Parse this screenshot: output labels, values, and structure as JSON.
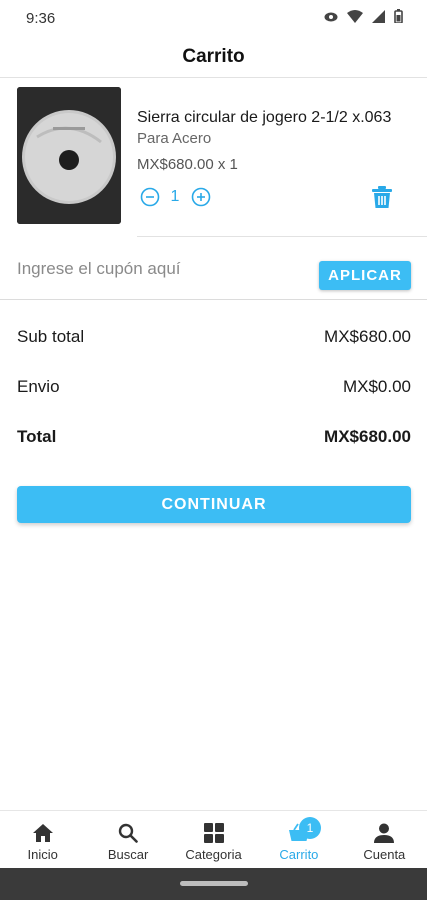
{
  "status_bar": {
    "time": "9:36",
    "icons": [
      "eye-icon",
      "wifi-icon",
      "signal-icon",
      "battery-icon"
    ]
  },
  "header": {
    "title": "Carrito"
  },
  "cart": {
    "items": [
      {
        "name": "Sierra circular de jogero 2-1/2 x.063",
        "subtitle": "Para Acero",
        "price_line": "MX$680.00 x 1",
        "quantity": "1",
        "image": "circular-saw-blade-photo"
      }
    ]
  },
  "coupon": {
    "placeholder": "Ingrese el cupón aquí",
    "value": "",
    "apply_label": "APLICAR"
  },
  "summary": {
    "subtotal_label": "Sub total",
    "subtotal_value": "MX$680.00",
    "shipping_label": "Envio",
    "shipping_value": "MX$0.00",
    "total_label": "Total",
    "total_value": "MX$680.00"
  },
  "continue_label": "CONTINUAR",
  "bottom_nav": {
    "items": [
      {
        "label": "Inicio",
        "icon": "home-icon"
      },
      {
        "label": "Buscar",
        "icon": "search-icon"
      },
      {
        "label": "Categoria",
        "icon": "grid-icon"
      },
      {
        "label": "Carrito",
        "icon": "basket-icon",
        "badge": "1",
        "active": true
      },
      {
        "label": "Cuenta",
        "icon": "person-icon"
      }
    ]
  },
  "colors": {
    "accent": "#3cbdf4",
    "accent_text": "#29a9e8",
    "system_bar": "#3a3a3a"
  }
}
